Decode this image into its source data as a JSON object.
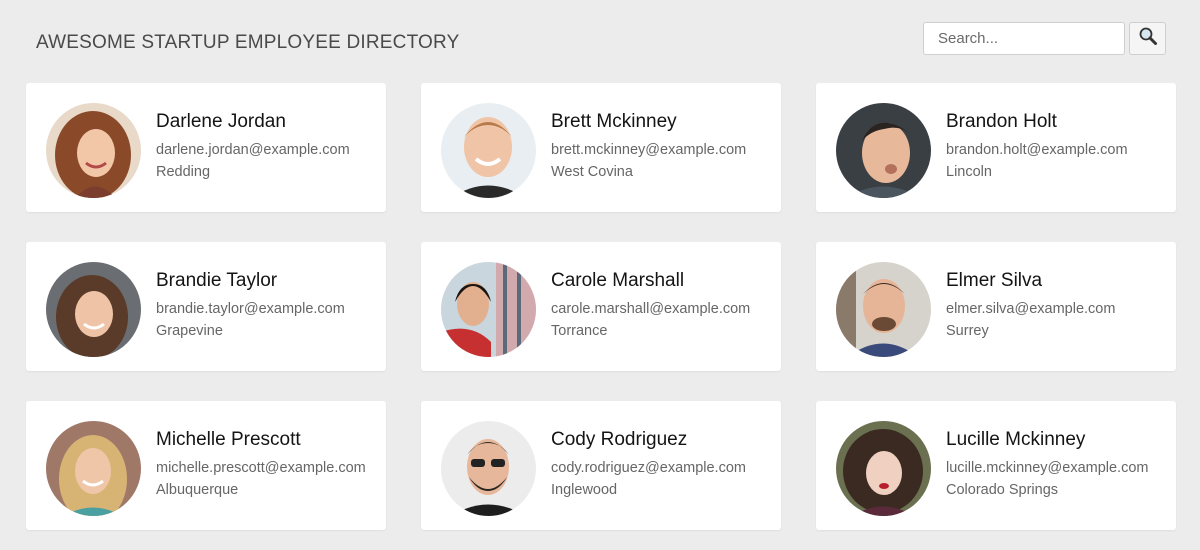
{
  "header": {
    "title": "AWESOME STARTUP EMPLOYEE DIRECTORY"
  },
  "search": {
    "placeholder": "Search...",
    "value": "",
    "button_icon": "magnifying-glass-icon"
  },
  "employees": [
    {
      "name": "Darlene Jordan",
      "email": "darlene.jordan@example.com",
      "city": "Redding"
    },
    {
      "name": "Brett Mckinney",
      "email": "brett.mckinney@example.com",
      "city": "West Covina"
    },
    {
      "name": "Brandon Holt",
      "email": "brandon.holt@example.com",
      "city": "Lincoln"
    },
    {
      "name": "Brandie Taylor",
      "email": "brandie.taylor@example.com",
      "city": "Grapevine"
    },
    {
      "name": "Carole Marshall",
      "email": "carole.marshall@example.com",
      "city": "Torrance"
    },
    {
      "name": "Elmer Silva",
      "email": "elmer.silva@example.com",
      "city": "Surrey"
    },
    {
      "name": "Michelle Prescott",
      "email": "michelle.prescott@example.com",
      "city": "Albuquerque"
    },
    {
      "name": "Cody Rodriguez",
      "email": "cody.rodriguez@example.com",
      "city": "Inglewood"
    },
    {
      "name": "Lucille Mckinney",
      "email": "lucille.mckinney@example.com",
      "city": "Colorado Springs"
    }
  ]
}
